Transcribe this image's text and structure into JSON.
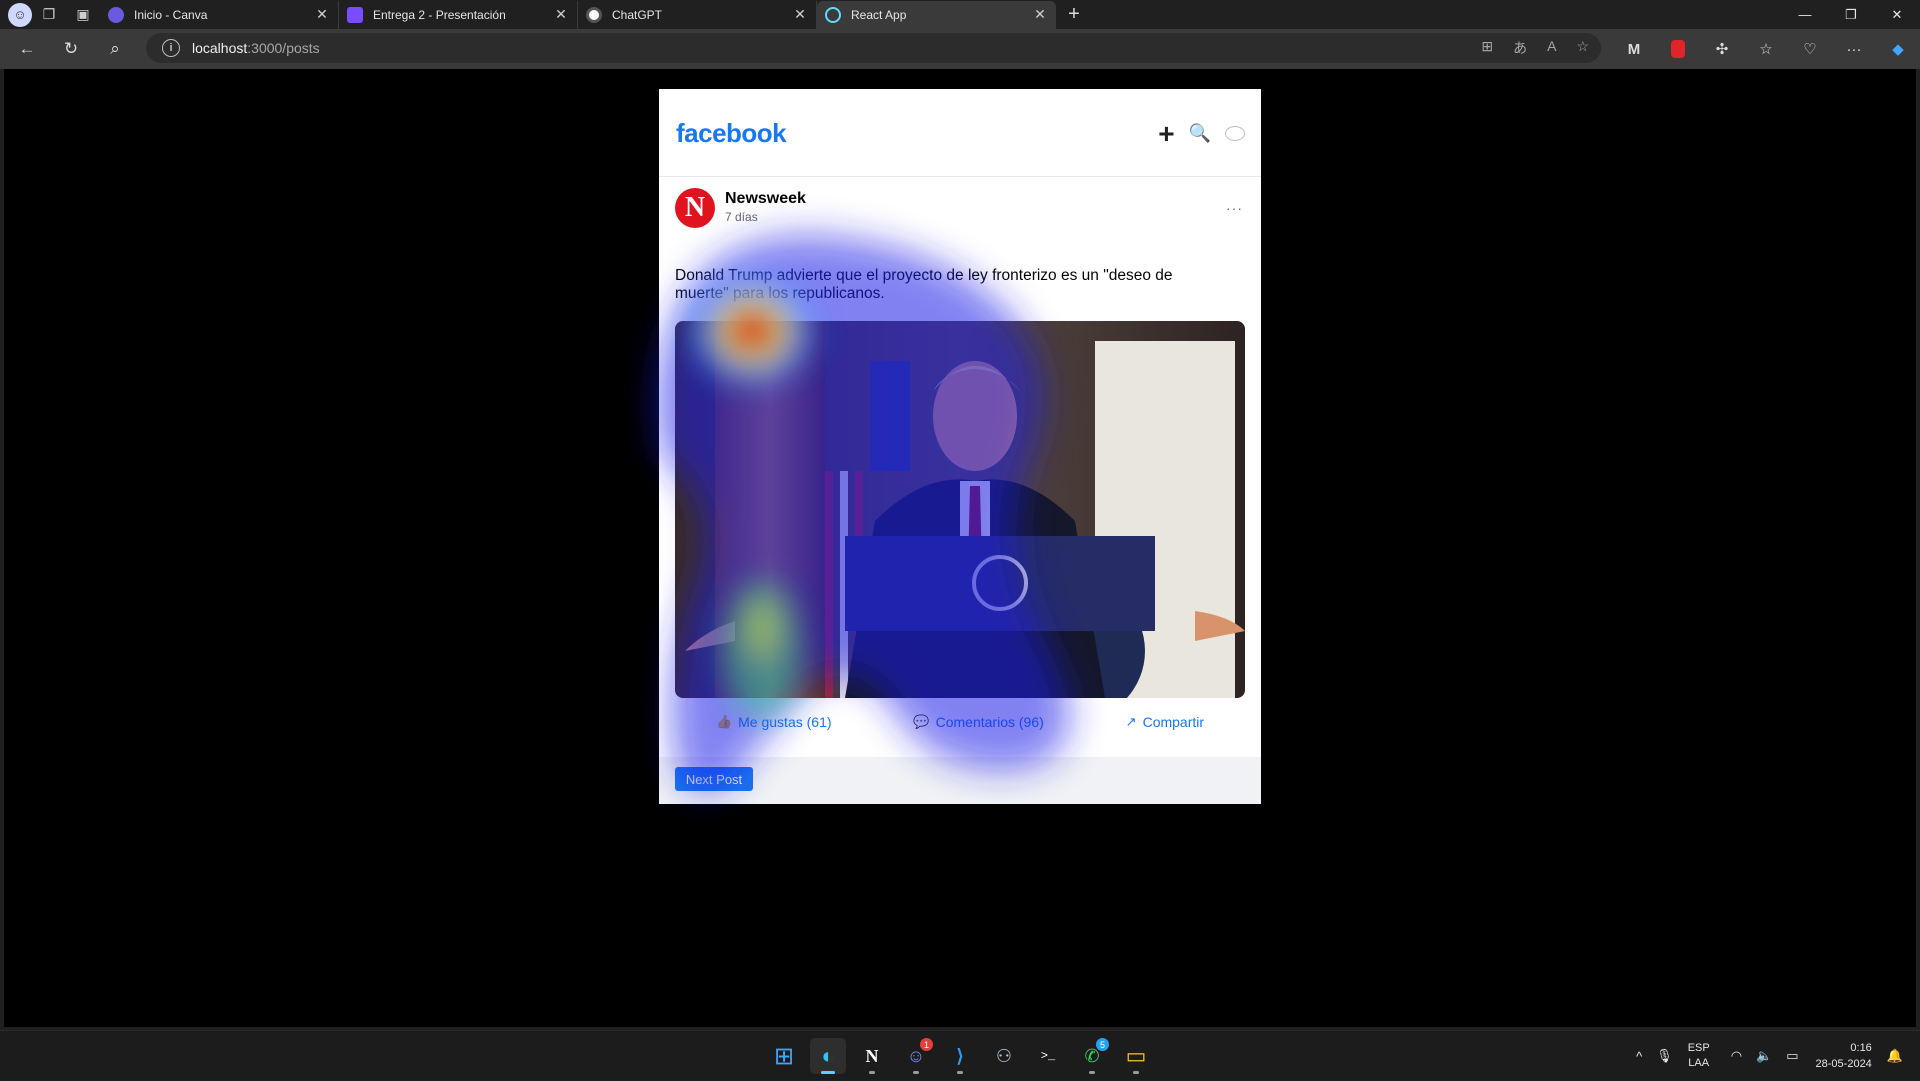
{
  "browser": {
    "tabs": [
      {
        "title": "Inicio - Canva",
        "color": "#6a5ae0",
        "active": false
      },
      {
        "title": "Entrega 2 - Presentación",
        "color": "#7b4bff",
        "active": false
      },
      {
        "title": "ChatGPT",
        "color": "#7a7a7a",
        "active": false
      },
      {
        "title": "React App",
        "color": "#61dafb",
        "active": true
      }
    ],
    "url_host": "localhost",
    "url_rest": ":3000/posts"
  },
  "app": {
    "logo": "facebook",
    "header_icons": [
      "plus-icon",
      "search-icon",
      "chat-icon"
    ]
  },
  "post": {
    "author": "Newsweek",
    "avatar_letter": "N",
    "time": "7 días",
    "more": "···",
    "text": "Donald Trump advierte que el proyecto de ley fronterizo es un \"deseo de muerte\" para los republicanos.",
    "actions": {
      "likes": "Me gustas (61)",
      "comments": "Comentarios (96)",
      "share": "Compartir"
    },
    "next_label": "Next Post"
  },
  "taskbar": {
    "apps": [
      {
        "name": "windows-start",
        "glyph": "⊞",
        "badge": ""
      },
      {
        "name": "edge",
        "glyph": "◐",
        "badge": ""
      },
      {
        "name": "notion",
        "glyph": "N",
        "badge": ""
      },
      {
        "name": "discord",
        "glyph": "☺",
        "badge": "1"
      },
      {
        "name": "vscode",
        "glyph": "⟩",
        "badge": ""
      },
      {
        "name": "github-desktop",
        "glyph": "⚇",
        "badge": ""
      },
      {
        "name": "terminal",
        "glyph": ">_",
        "badge": ""
      },
      {
        "name": "whatsapp",
        "glyph": "✆",
        "badge": "5"
      },
      {
        "name": "file-explorer",
        "glyph": "▭",
        "badge": ""
      }
    ],
    "lang_top": "ESP",
    "lang_bottom": "LAA",
    "time": "0:16",
    "date": "28-05-2024"
  }
}
